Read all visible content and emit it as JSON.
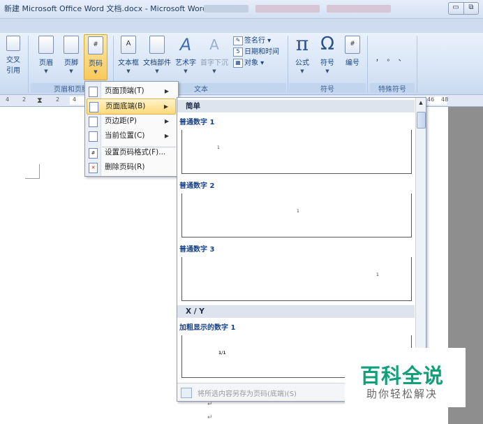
{
  "window": {
    "title": "新建 Microsoft Office Word 文档.docx - Microsoft Word"
  },
  "ribbon": {
    "cross_ref": {
      "label_line1": "交叉",
      "label_line2": "引用"
    },
    "header_label": "页眉",
    "footer_label": "页脚",
    "pagenum_label": "页码",
    "group_header_footer": "页眉和页脚",
    "textbox_label": "文本框",
    "quickparts_label": "文档部件",
    "wordart_label": "艺术字",
    "dropcap_label": "首字下沉",
    "signature_line": "签名行",
    "datetime": "日期和时间",
    "object": "对象",
    "group_text": "文本",
    "formula_label": "公式",
    "symbol_label": "符号",
    "number_label": "编号",
    "group_symbols": "符号",
    "special_symbol_label": "符号",
    "group_special": "特殊符号",
    "special_chars_row1": "，  。  、",
    "special_chars_row2": "；  ：  ？"
  },
  "ruler": {
    "left_nums": [
      "4",
      "2"
    ],
    "right_nums": [
      "2",
      "4"
    ],
    "far_right_nums": [
      "46",
      "48"
    ]
  },
  "pagenum_menu": {
    "items": [
      {
        "label": "页面顶端(T)",
        "has_submenu": true
      },
      {
        "label": "页面底端(B)",
        "has_submenu": true,
        "active": true
      },
      {
        "label": "页边距(P)",
        "has_submenu": true
      },
      {
        "label": "当前位置(C)",
        "has_submenu": true
      },
      {
        "label": "设置页码格式(F)...",
        "has_submenu": false
      },
      {
        "label": "删除页码(R)",
        "has_submenu": false
      }
    ]
  },
  "gallery": {
    "section_simple": "简单",
    "items": [
      {
        "title": "普通数字 1",
        "sample": "1"
      },
      {
        "title": "普通数字 2",
        "sample": "1"
      },
      {
        "title": "普通数字 3",
        "sample": "1"
      }
    ],
    "section_xy": "X / Y",
    "xy_items": [
      {
        "title": "加粗显示的数字 1",
        "sample": "1/1"
      }
    ],
    "footer_text": "将所选内容另存为页码(底端)(S)"
  },
  "watermark": {
    "line1": "百科全说",
    "line2": "助你轻松解决"
  },
  "colors": {
    "ribbon_text": "#15428b",
    "menu_highlight": "#fed97a",
    "watermark_green": "#10a07a"
  }
}
